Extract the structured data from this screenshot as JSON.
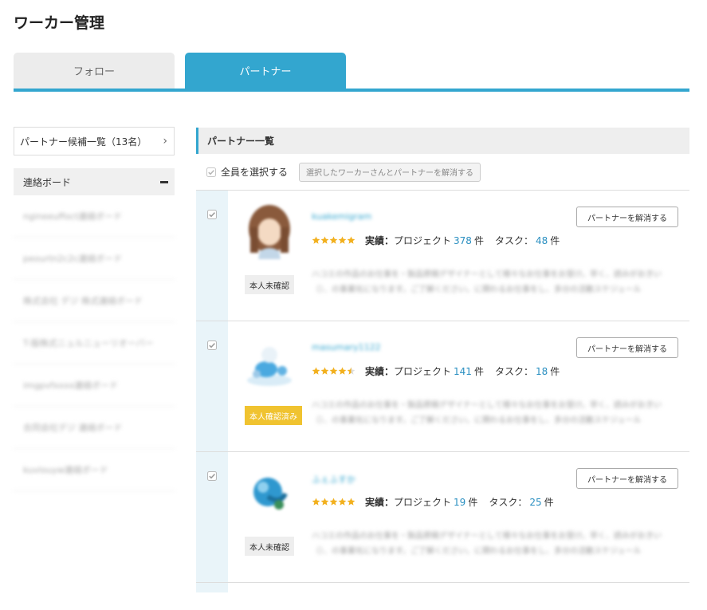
{
  "page": {
    "title": "ワーカー管理"
  },
  "tabs": {
    "follow": "フォロー",
    "partner": "パートナー"
  },
  "sidebar": {
    "candidates_label": "パートナー候補一覧（13名）",
    "board_title": "連絡ボード",
    "boards": [
      "ngineeuffoct連絡ボード",
      "peourtn2c2c連絡ボード",
      "株式会社 デジ 株式連絡ボード",
      "T-版株式ニュルニューリオーバー",
      "imgpvfxxxx連絡ボード",
      "合同会社デジ 連絡ボード",
      "kuvlouyw連絡ボード"
    ]
  },
  "main": {
    "section_title": "パートナー一覧",
    "select_all_label": "全員を選択する",
    "dissolve_selected_label": "選択したワーカーさんとパートナーを解消する",
    "stat_label": "実績：",
    "project_label": "プロジェクト",
    "task_label": "タスク：",
    "count_unit": "件",
    "dissolve_label": "パートナーを解消する",
    "partners": [
      {
        "username": "kuakemigram",
        "rating": 5,
        "projects": "378",
        "tasks": "48",
        "status": "本人未確認",
        "description": "ハコエの作品のお仕事を・製品原稿デザイナーとして様々なお仕事をお受け。早く、読みがおきい（）、の事業化になります。ご了解ください。に関わるお仕事をし、多分の活動スケジュール"
      },
      {
        "username": "masumary1122",
        "rating": 4.5,
        "projects": "141",
        "tasks": "18",
        "status": "本人確認済み",
        "description": "ハコエの作品のお仕事を・製品原稿デザイナーとして様々なお仕事をお受け。早く、読みがおきい（）、の事業化になります。ご了解ください。に関わるお仕事をし、多分の活動スケジュール"
      },
      {
        "username": "ふぇふすか",
        "rating": 5,
        "projects": "19",
        "tasks": "25",
        "status": "本人未確認",
        "description": "ハコエの作品のお仕事を・製品原稿デザイナーとして様々なお仕事をお受け。早く、読みがおきい（）、の事業化になります。ご了解ください。に関わるお仕事をし、多分の活動スケジュール"
      }
    ]
  },
  "colors": {
    "accent": "#33a6cf",
    "verified": "#f0c330",
    "star": "#f2b01e",
    "number": "#2a8fc1"
  },
  "icons": {
    "check": "check-square-icon",
    "star": "star-icon",
    "chevron": "chevron-right-icon",
    "collapse": "minus-icon"
  }
}
